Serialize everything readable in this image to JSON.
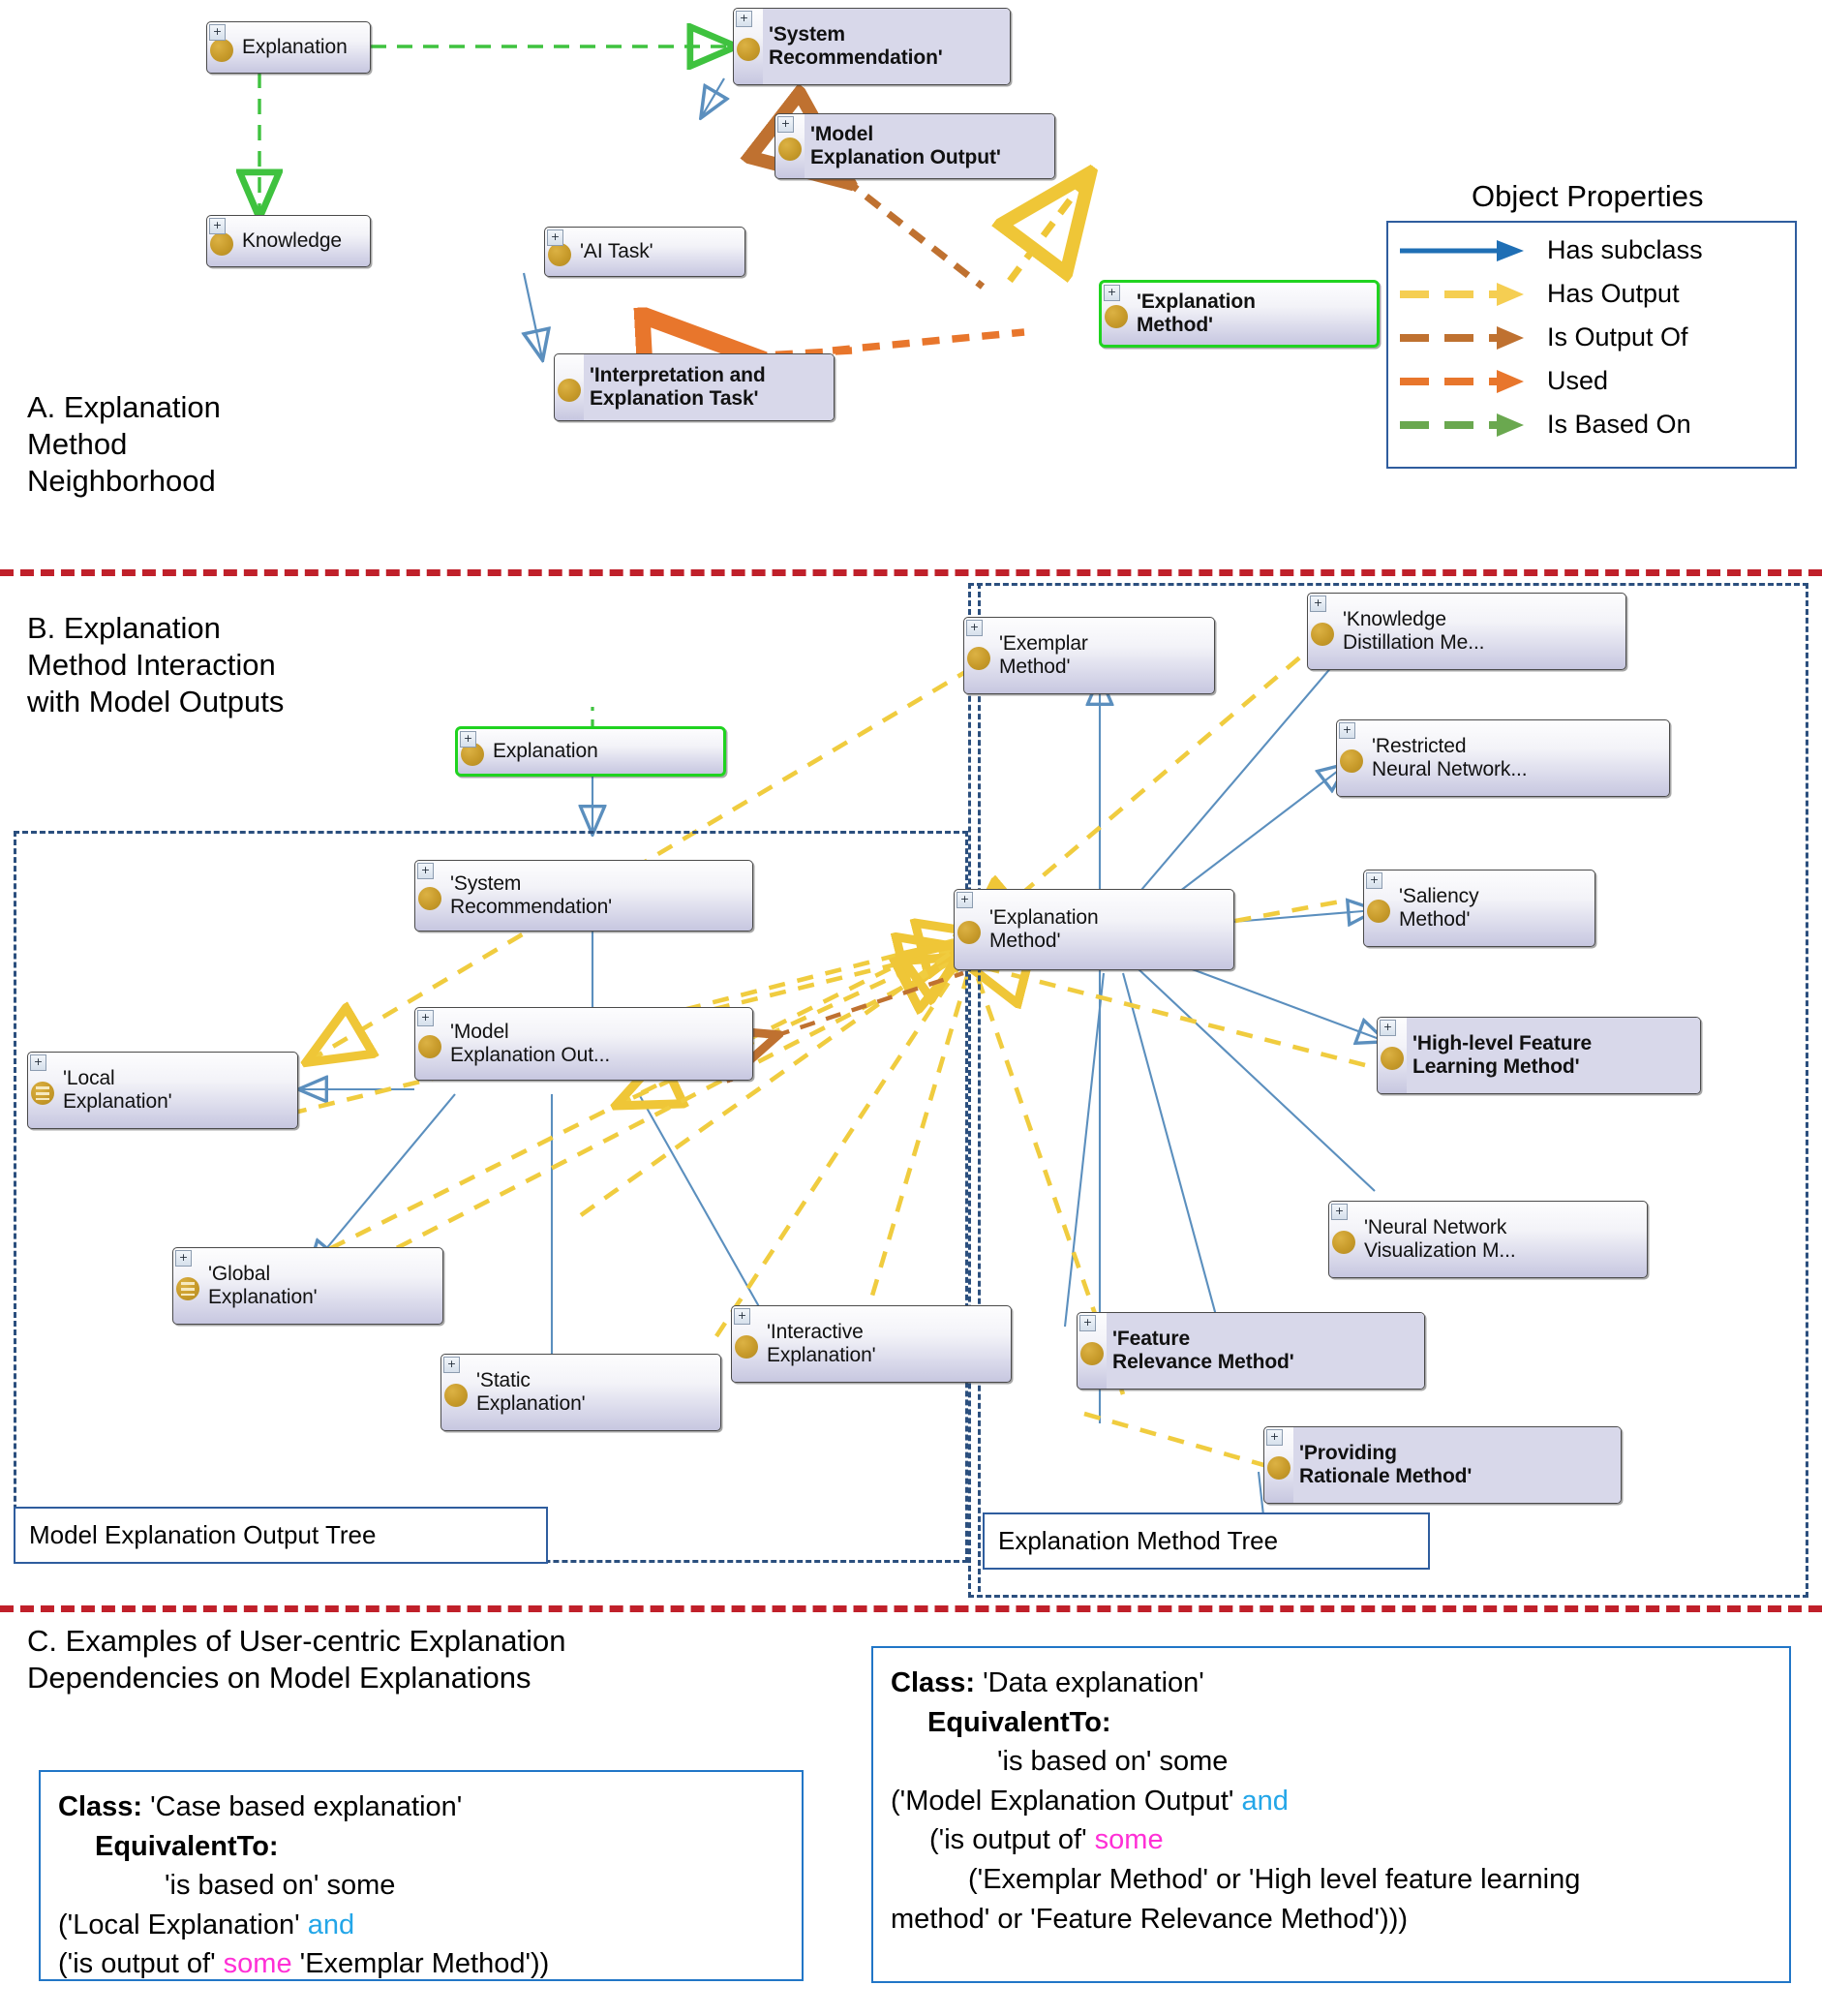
{
  "sections": {
    "a_title": "A. Explanation\nMethod\nNeighborhood",
    "b_title": "B. Explanation\nMethod Interaction\nwith Model Outputs",
    "c_title": "C. Examples of User-centric Explanation\nDependencies on Model Explanations"
  },
  "legend": {
    "title": "Object Properties",
    "items": [
      {
        "label": "Has subclass",
        "color": "#1f6fb5",
        "style": "solid"
      },
      {
        "label": "Has Output",
        "color": "#f5ce52",
        "style": "dashed"
      },
      {
        "label": "Is Output Of",
        "color": "#bf7130",
        "style": "dashed"
      },
      {
        "label": "Used",
        "color": "#e8762c",
        "style": "dashed"
      },
      {
        "label": "Is Based On",
        "color": "#6aa84f",
        "style": "dashed"
      }
    ]
  },
  "panelA": {
    "nodes": [
      {
        "id": "a-explanation",
        "label": "Explanation"
      },
      {
        "id": "a-sysrec",
        "label": "'System\nRecommendation'"
      },
      {
        "id": "a-knowledge",
        "label": "Knowledge"
      },
      {
        "id": "a-modelout",
        "label": "'Model\nExplanation Output'"
      },
      {
        "id": "a-aitask",
        "label": "'AI Task'"
      },
      {
        "id": "a-interp",
        "label": "'Interpretation and\nExplanation Task'"
      },
      {
        "id": "a-expmethod",
        "label": "'Explanation\nMethod'"
      }
    ]
  },
  "panelB": {
    "group_left_label": "Model Explanation Output Tree",
    "group_right_label": "Explanation Method Tree",
    "nodes": [
      {
        "id": "b-explanation",
        "label": "Explanation"
      },
      {
        "id": "b-sysrec",
        "label": "'System\nRecommendation'"
      },
      {
        "id": "b-modelout",
        "label": "'Model\nExplanation Out..."
      },
      {
        "id": "b-local",
        "label": "'Local\nExplanation'"
      },
      {
        "id": "b-global",
        "label": "'Global\nExplanation'"
      },
      {
        "id": "b-static",
        "label": "'Static\nExplanation'"
      },
      {
        "id": "b-interactive",
        "label": "'Interactive\nExplanation'"
      },
      {
        "id": "b-exemplar",
        "label": "'Exemplar\nMethod'"
      },
      {
        "id": "b-knowdist",
        "label": "'Knowledge\nDistillation Me..."
      },
      {
        "id": "b-restricted",
        "label": "'Restricted\nNeural Network..."
      },
      {
        "id": "b-expmethod",
        "label": "'Explanation\nMethod'"
      },
      {
        "id": "b-saliency",
        "label": "'Saliency\nMethod'"
      },
      {
        "id": "b-highlevel",
        "label": "'High-level Feature\nLearning Method'"
      },
      {
        "id": "b-nnvis",
        "label": "'Neural Network\nVisualization M..."
      },
      {
        "id": "b-featrel",
        "label": "'Feature\nRelevance Method'"
      },
      {
        "id": "b-rationale",
        "label": "'Providing\nRationale Method'"
      }
    ]
  },
  "panelC": {
    "left_box": {
      "l1_label": "Class:",
      "l1_value": " 'Case based explanation'",
      "l2": "EquivalentTo:",
      "l3": "'is based on' some",
      "l4_pre": "('Local Explanation' ",
      "l4_and": "and",
      "l5_pre": "('is output of' ",
      "l5_some": "some",
      "l5_post": " 'Exemplar Method'))"
    },
    "right_box": {
      "l1_label": "Class:",
      "l1_value": " 'Data explanation'",
      "l2": "EquivalentTo:",
      "l3": "'is based on' some",
      "l4_pre": "('Model Explanation Output' ",
      "l4_and": "and",
      "l5_pre": "('is output of' ",
      "l5_some": "some",
      "l6": "('Exemplar Method' or 'High level feature learning",
      "l7": "method' or 'Feature Relevance Method')))"
    }
  }
}
